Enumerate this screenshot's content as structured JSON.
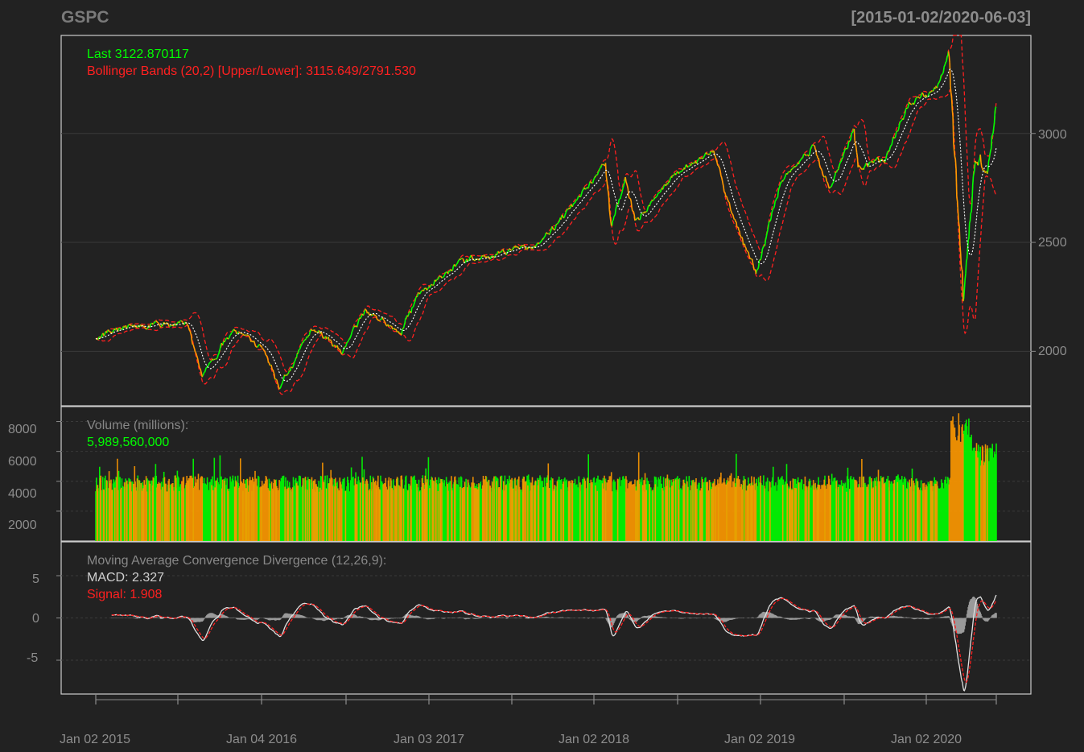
{
  "header": {
    "symbol": "GSPC",
    "date_range": "[2015-01-02/2020-06-03]"
  },
  "colors": {
    "background": "#222222",
    "up": "#00ff00",
    "down": "#ff9900",
    "bands": "#ff2020",
    "ma": "#ffffff",
    "axis": "#8c8c8c",
    "panel_border": "#cccccc",
    "grid": "#3a3a3a"
  },
  "price_panel": {
    "last_label": "Last 3122.870117",
    "bbands_label": "Bollinger Bands (20,2) [Upper/Lower]: 3115.649/2791.530",
    "yticks": [
      "2000",
      "2500",
      "3000"
    ]
  },
  "volume_panel": {
    "label": "Volume (millions):",
    "value": "5,989,560,000",
    "yticks": [
      "2000",
      "4000",
      "6000",
      "8000"
    ]
  },
  "macd_panel": {
    "label": "Moving Average Convergence Divergence (12,26,9):",
    "macd_label": "MACD: 2.327",
    "signal_label": "Signal: 1.908",
    "yticks": [
      "-5",
      "0",
      "5"
    ]
  },
  "xaxis": {
    "labels": [
      "Jan 02 2015",
      "Jan 04 2016",
      "Jan 03 2017",
      "Jan 02 2018",
      "Jan 02 2019",
      "Jan 02 2020"
    ]
  },
  "chart_data": {
    "type": "line",
    "title": "GSPC",
    "subtitle": "[2015-01-02/2020-06-03]",
    "price": {
      "ylim": [
        1750,
        3450
      ],
      "x": [
        "2015-01-02",
        "2015-03-02",
        "2015-05-20",
        "2015-07-20",
        "2015-08-25",
        "2015-11-03",
        "2016-01-04",
        "2016-02-11",
        "2016-04-20",
        "2016-06-27",
        "2016-08-15",
        "2016-11-04",
        "2016-12-13",
        "2017-03-01",
        "2017-06-19",
        "2017-09-15",
        "2018-01-26",
        "2018-02-08",
        "2018-03-12",
        "2018-04-02",
        "2018-06-11",
        "2018-09-20",
        "2018-10-29",
        "2018-12-24",
        "2019-02-15",
        "2019-04-30",
        "2019-06-03",
        "2019-07-26",
        "2019-08-05",
        "2019-10-02",
        "2019-11-29",
        "2020-01-31",
        "2020-02-19",
        "2020-03-09",
        "2020-03-23",
        "2020-04-17",
        "2020-05-14",
        "2020-06-03"
      ],
      "close": [
        2058,
        2117,
        2130,
        2128,
        1893,
        2110,
        2012,
        1829,
        2102,
        2000,
        2190,
        2085,
        2271,
        2395,
        2453,
        2500,
        2872,
        2581,
        2783,
        2581,
        2782,
        2930,
        2641,
        2351,
        2775,
        2946,
        2744,
        3025,
        2844,
        2887,
        3141,
        3225,
        3386,
        2746,
        2237,
        2875,
        2820,
        3122
      ]
    },
    "volume": {
      "ylim": [
        0,
        9000
      ],
      "unit": "millions"
    },
    "macd": {
      "params": "12,26,9",
      "ylim": [
        -9,
        9
      ],
      "last_macd": 2.327,
      "last_signal": 1.908
    },
    "bbands": {
      "params": "20,2",
      "last_upper": 3115.649,
      "last_lower": 2791.53
    }
  }
}
